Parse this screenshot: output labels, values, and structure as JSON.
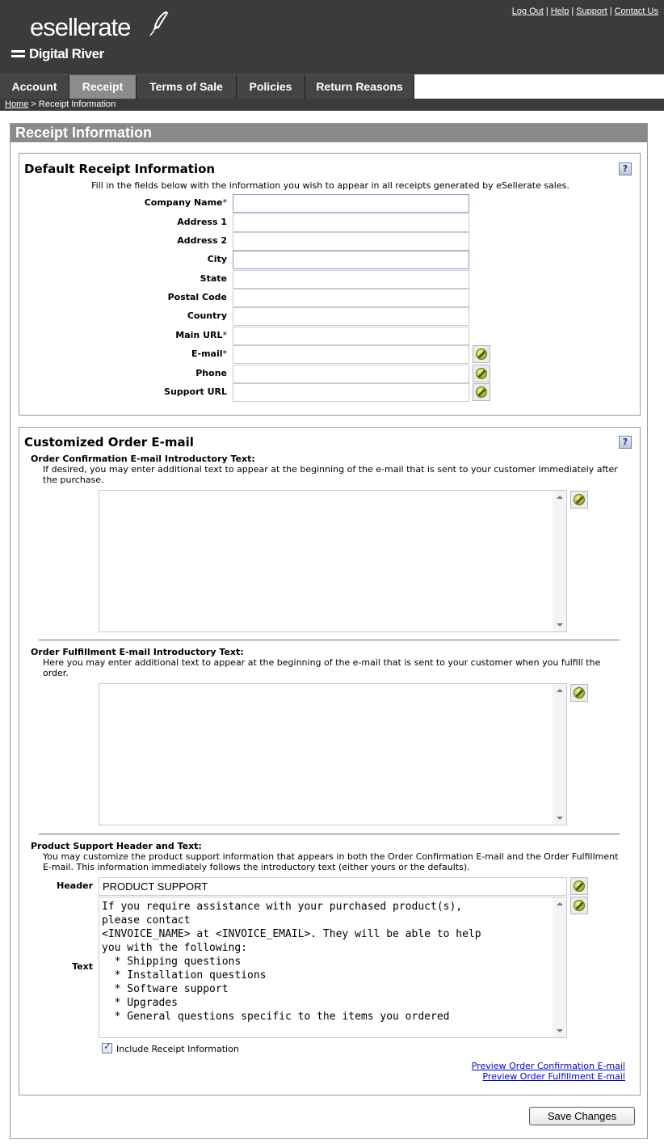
{
  "header": {
    "logo_main": "esellerate",
    "logo_sub": "Digital River",
    "links": [
      "Log Out",
      "Help",
      "Support",
      "Contact Us"
    ]
  },
  "tabs": [
    "Account",
    "Receipt",
    "Terms of Sale",
    "Policies",
    "Return Reasons"
  ],
  "active_tab": "Receipt",
  "breadcrumb": {
    "home": "Home",
    "separator": ">",
    "current": "Receipt Information"
  },
  "page_title": "Receipt Information",
  "receipt": {
    "title": "Default Receipt Information",
    "help": "?",
    "intro": "Fill in the fields below with the information you wish to appear in all receipts generated by eSellerate sales.",
    "fields": [
      {
        "label": "Company Name",
        "required": true,
        "value": ""
      },
      {
        "label": "Address 1",
        "required": false,
        "value": ""
      },
      {
        "label": "Address 2",
        "required": false,
        "value": ""
      },
      {
        "label": "City",
        "required": false,
        "value": ""
      },
      {
        "label": "State",
        "required": false,
        "value": ""
      },
      {
        "label": "Postal Code",
        "required": false,
        "value": ""
      },
      {
        "label": "Country",
        "required": false,
        "value": ""
      },
      {
        "label": "Main URL",
        "required": true,
        "value": ""
      },
      {
        "label": "E-mail",
        "required": true,
        "value": ""
      },
      {
        "label": "Phone",
        "required": false,
        "value": ""
      },
      {
        "label": "Support URL",
        "required": false,
        "value": ""
      }
    ],
    "required_marker": "*"
  },
  "email": {
    "title": "Customized Order E-mail",
    "help": "?",
    "confirmation": {
      "label": "Order Confirmation E-mail Introductory Text:",
      "desc": "If desired, you may enter additional text to appear at the beginning of the e-mail that is sent to your customer immediately after the purchase.",
      "value": ""
    },
    "fulfillment": {
      "label": "Order Fulfillment E-mail Introductory Text:",
      "desc": "Here you may enter additional text to appear at the beginning of the e-mail that is sent to your customer when you fulfill the order.",
      "value": ""
    },
    "support": {
      "label": "Product Support Header and Text:",
      "desc": "You may customize the product support information that appears in both the Order Confirmation E-mail and the Order Fulfillment E-mail. This information immediately follows the introductory text (either yours or the defaults).",
      "header_label": "Header",
      "header_value": "PRODUCT SUPPORT",
      "text_label": "Text",
      "text_value": "If you require assistance with your purchased product(s),\nplease contact\n<INVOICE_NAME> at <INVOICE_EMAIL>. They will be able to help\nyou with the following:\n  * Shipping questions\n  * Installation questions\n  * Software support\n  * Upgrades\n  * General questions specific to the items you ordered"
    },
    "include_receipt_label": "Include Receipt Information",
    "include_receipt_checked": true,
    "preview_confirmation": "Preview Order Confirmation E-mail",
    "preview_fulfillment": "Preview Order Fulfillment E-mail"
  },
  "save_label": "Save Changes"
}
